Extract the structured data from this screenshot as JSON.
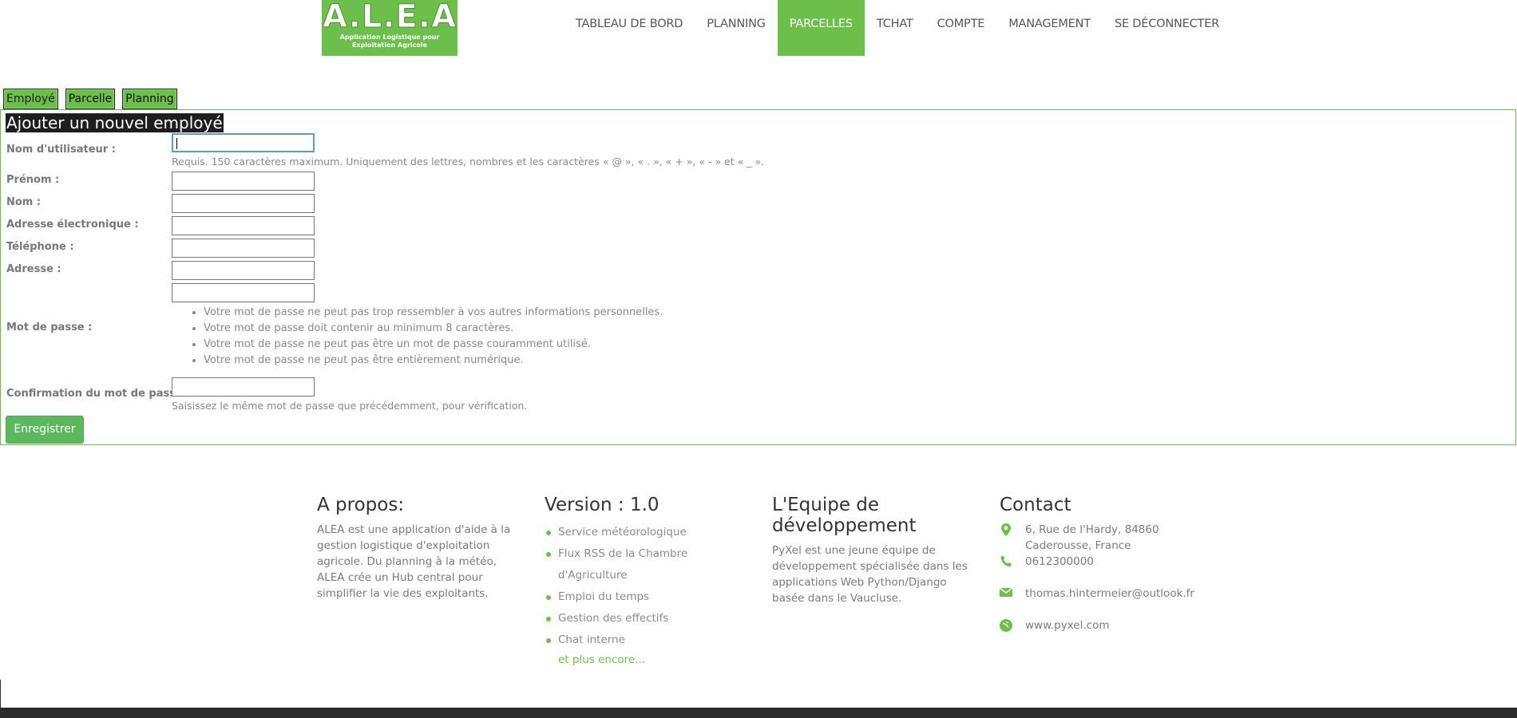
{
  "logo": {
    "title": "A.L.E.A",
    "subtitle_line1": "Application Logistique pour",
    "subtitle_line2": "Exploitation Agricole"
  },
  "nav": [
    {
      "label": "TABLEAU DE BORD"
    },
    {
      "label": "PLANNING"
    },
    {
      "label": "PARCELLES"
    },
    {
      "label": "TCHAT"
    },
    {
      "label": "COMPTE"
    },
    {
      "label": "MANAGEMENT"
    },
    {
      "label": "SE DÉCONNECTER"
    }
  ],
  "tabs": [
    {
      "label": "Employé"
    },
    {
      "label": "Parcelle"
    },
    {
      "label": "Planning"
    }
  ],
  "form": {
    "title": "Ajouter un nouvel employé",
    "username_label": "Nom d'utilisateur :",
    "username_value": "",
    "username_help": "Requis. 150 caractères maximum. Uniquement des lettres, nombres et les caractères « @ », « . », « + », « - » et « _ ».",
    "firstname_label": "Prénom :",
    "lastname_label": "Nom :",
    "email_label": "Adresse électronique :",
    "phone_label": "Téléphone :",
    "address_label": "Adresse :",
    "password_label": "Mot de passe :",
    "password_rules": [
      "Votre mot de passe ne peut pas trop ressembler à vos autres informations personnelles.",
      "Votre mot de passe doit contenir au minimum 8 caractères.",
      "Votre mot de passe ne peut pas être un mot de passe couramment utilisé.",
      "Votre mot de passe ne peut pas être entièrement numérique."
    ],
    "confirm_label": "Confirmation du mot de passe :",
    "confirm_help": "Saisissez le même mot de passe que précédemment, pour vérification.",
    "submit_label": "Enregistrer"
  },
  "footer": {
    "about": {
      "title": "A propos:",
      "text": "ALEA est une application d'aide à la gestion logistique d'exploitation agricole. Du planning à la météo, ALEA crée un Hub central pour simplifier la vie des exploitants."
    },
    "version": {
      "title": "Version : 1.0",
      "items": [
        "Service météorologique",
        "Flux RSS de la Chambre d'Agriculture",
        "Emploi du temps",
        "Gestion des effectifs",
        "Chat interne"
      ],
      "more": "et plus encore..."
    },
    "team": {
      "title": "L'Equipe de développement",
      "text": "PyXel est une jeune équipe de développement spécialisée dans les applications Web Python/Django basée dans le Vaucluse."
    },
    "contact": {
      "title": "Contact",
      "address": "6, Rue de l'Hardy, 84860 Caderousse, France",
      "phone": "0612300000",
      "email": "thomas.hintermeier@outlook.fr",
      "website": "www.pyxel.com"
    }
  },
  "colors": {
    "accent": "#6cbf4a",
    "button": "#5cb85c",
    "footer_bar": "#2c2c2c"
  }
}
